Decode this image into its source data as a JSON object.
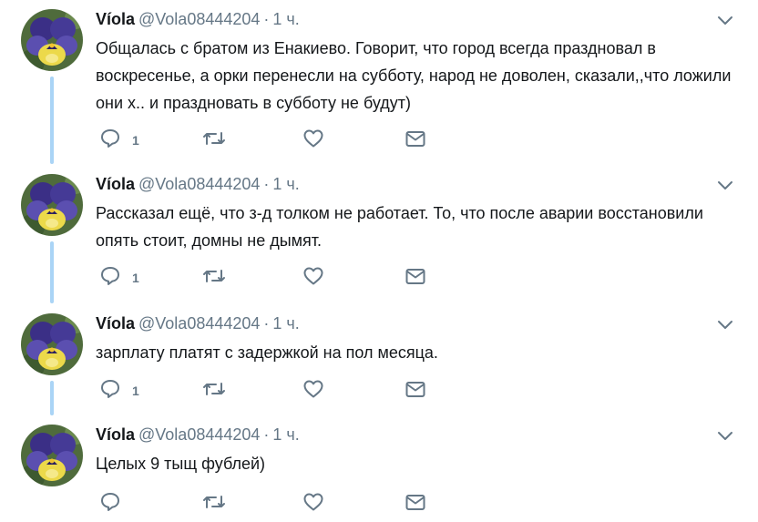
{
  "tweets": [
    {
      "author_name": "Víola",
      "handle": "@Vola08444204",
      "separator": "·",
      "time": "1 ч.",
      "text": "Общалась с братом из Енакиево. Говорит, что город всегда праздновал в воскресенье, а орки перенесли на субботу, народ не доволен, сказали,,что ложили они х.. и праздновать в субботу не будут)",
      "reply_count": "1"
    },
    {
      "author_name": "Víola",
      "handle": "@Vola08444204",
      "separator": "·",
      "time": "1 ч.",
      "text": "Рассказал ещё, что з-д толком не работает. То, что после аварии восстановили опять стоит, домны не дымят.",
      "reply_count": "1"
    },
    {
      "author_name": "Víola",
      "handle": "@Vola08444204",
      "separator": "·",
      "time": "1 ч.",
      "text": "зарплату платят с  задержкой на пол месяца.",
      "reply_count": "1"
    },
    {
      "author_name": "Víola",
      "handle": "@Vola08444204",
      "separator": "·",
      "time": "1 ч.",
      "text": "Целых 9 тыщ фублей)",
      "reply_count": ""
    }
  ],
  "icons": {
    "reply": "reply-icon",
    "retweet": "retweet-icon",
    "like": "heart-icon",
    "message": "envelope-icon",
    "caret": "chevron-down-icon"
  },
  "colors": {
    "text": "#14171a",
    "secondary": "#657786",
    "thread_line": "#aad4f6"
  }
}
